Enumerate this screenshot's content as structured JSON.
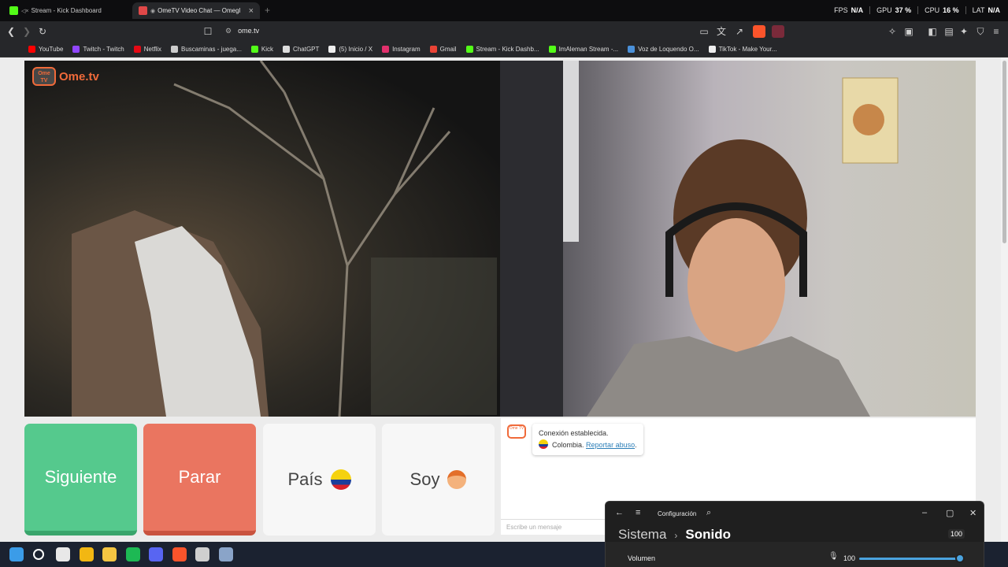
{
  "browser": {
    "tabs": [
      {
        "title": "Stream - Kick Dashboard",
        "favicon_color": "#53fc18",
        "active": false
      },
      {
        "title": "OmeTV Video Chat — Omegl",
        "favicon_color": "#e04848",
        "active": true,
        "muted": true
      }
    ],
    "new_tab_label": "+",
    "perf": [
      {
        "label": "FPS",
        "value": "N/A"
      },
      {
        "label": "GPU",
        "value": "37 %"
      },
      {
        "label": "CPU",
        "value": "16 %"
      },
      {
        "label": "LAT",
        "value": "N/A"
      }
    ],
    "url": "ome.tv",
    "bookmarks": [
      {
        "label": "YouTube",
        "color": "#ff0000"
      },
      {
        "label": "Twitch - Twitch",
        "color": "#9146ff"
      },
      {
        "label": "Netflix",
        "color": "#e50914"
      },
      {
        "label": "Buscaminas - juega...",
        "color": "#cccccc"
      },
      {
        "label": "Kick",
        "color": "#53fc18"
      },
      {
        "label": "ChatGPT",
        "color": "#dddddd"
      },
      {
        "label": "(5) Inicio / X",
        "color": "#eeeeee"
      },
      {
        "label": "Instagram",
        "color": "#e1306c"
      },
      {
        "label": "Gmail",
        "color": "#ea4335"
      },
      {
        "label": "Stream - Kick Dashb...",
        "color": "#53fc18"
      },
      {
        "label": "ImAleman Stream -...",
        "color": "#53fc18"
      },
      {
        "label": "Voz de Loquendo O...",
        "color": "#4a90d9"
      },
      {
        "label": "TikTok - Make Your...",
        "color": "#eeeeee"
      }
    ]
  },
  "ometv": {
    "logo_small": "Ome TV",
    "logo_text": "Ome.tv",
    "buttons": {
      "next": "Siguiente",
      "stop": "Parar",
      "country": "País",
      "gender": "Soy"
    },
    "chat": {
      "status": "Conexión establecida.",
      "country": "Colombia.",
      "report_link": "Reportar abuso",
      "report_suffix": ".",
      "input_placeholder": "Escribe un mensaje"
    }
  },
  "settings_window": {
    "app_name": "Configuración",
    "breadcrumb_parent": "Sistema",
    "breadcrumb_current": "Sonido",
    "volume_label": "Volumen",
    "volume_value": "100",
    "volume_badge": "100",
    "volume_fraction": 1.0
  },
  "taskbar": {
    "apps": [
      {
        "name": "start-icon",
        "color": "#3b9ce8"
      },
      {
        "name": "search-icon",
        "color": "#ffffff"
      },
      {
        "name": "store-icon",
        "color": "#e8e8e8"
      },
      {
        "name": "chrome-icon",
        "color": "#f2b712"
      },
      {
        "name": "explorer-icon",
        "color": "#f4c542"
      },
      {
        "name": "spotify-icon",
        "color": "#1db954"
      },
      {
        "name": "discord-icon",
        "color": "#5865f2"
      },
      {
        "name": "brave-icon",
        "color": "#fb542b"
      },
      {
        "name": "obs-icon",
        "color": "#cfcfcf"
      },
      {
        "name": "settings-icon",
        "color": "#8aa4c8"
      }
    ]
  }
}
